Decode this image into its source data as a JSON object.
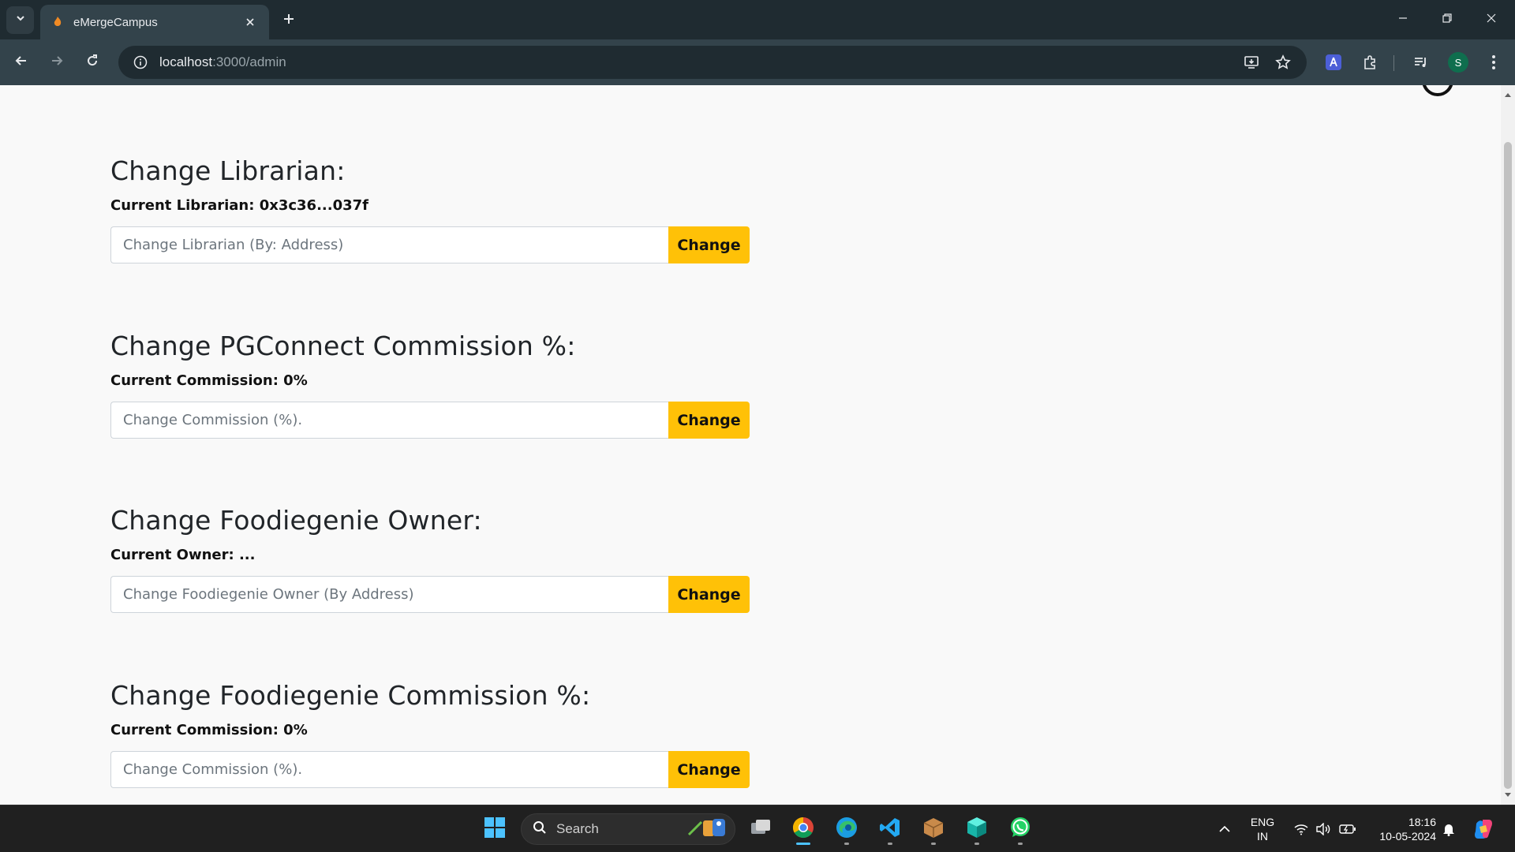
{
  "browser": {
    "tab_title": "eMergeCampus",
    "url_host": "localhost",
    "url_path": ":3000/admin",
    "profile_initial": "S"
  },
  "sections": [
    {
      "heading": "Change Librarian:",
      "current": "Current Librarian: 0x3c36...037f",
      "placeholder": "Change Librarian (By: Address)",
      "button": "Change"
    },
    {
      "heading": "Change PGConnect Commission %:",
      "current": "Current Commission: 0%",
      "placeholder": "Change Commission (%).",
      "button": "Change"
    },
    {
      "heading": "Change Foodiegenie Owner:",
      "current": "Current Owner: ...",
      "placeholder": "Change Foodiegenie Owner (By Address)",
      "button": "Change"
    },
    {
      "heading": "Change Foodiegenie Commission %:",
      "current": "Current Commission: 0%",
      "placeholder": "Change Commission (%).",
      "button": "Change"
    }
  ],
  "taskbar": {
    "search_label": "Search",
    "lang_line1": "ENG",
    "lang_line2": "IN",
    "time": "18:16",
    "date": "10-05-2024"
  },
  "colors": {
    "accent_button": "#ffc107",
    "chrome_dark": "#1f2b31",
    "chrome_toolbar": "#33434b",
    "page_bg": "#f9f9f9"
  }
}
